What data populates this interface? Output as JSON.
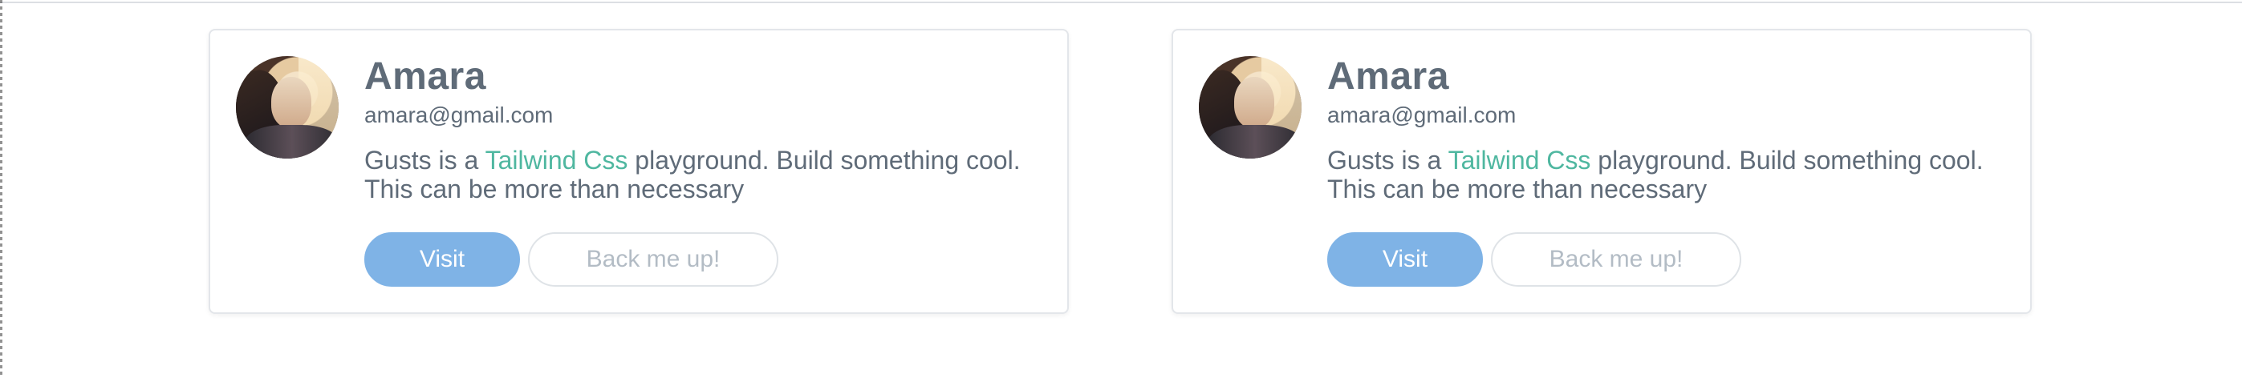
{
  "cards": [
    {
      "name": "Amara",
      "email": "amara@gmail.com",
      "desc_prefix": "Gusts is a ",
      "desc_link": "Tailwind Css",
      "desc_suffix": " playground. Build something cool. This can be more than necessary",
      "visit_label": "Visit",
      "back_label": "Back me up!"
    },
    {
      "name": "Amara",
      "email": "amara@gmail.com",
      "desc_prefix": "Gusts is a ",
      "desc_link": "Tailwind Css",
      "desc_suffix": " playground. Build something cool. This can be more than necessary",
      "visit_label": "Visit",
      "back_label": "Back me up!"
    }
  ],
  "colors": {
    "text": "#5f6b78",
    "link": "#4fb7a0",
    "primary_button": "#7fb3e6",
    "secondary_button_text": "#b3bcc5",
    "border": "#e3e6ea"
  }
}
